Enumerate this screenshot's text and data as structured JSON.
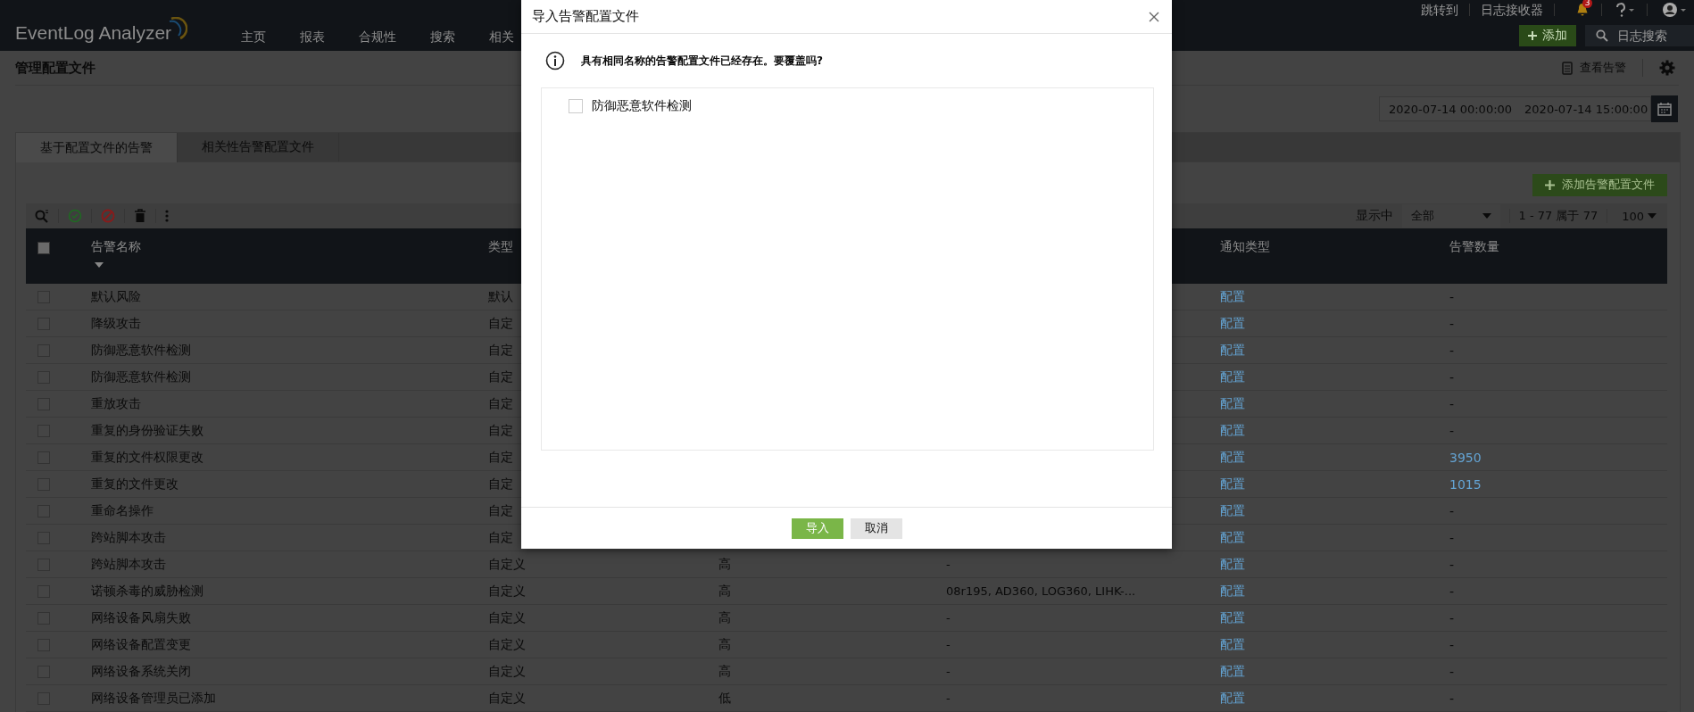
{
  "header": {
    "logo": "EventLog Analyzer",
    "nav": [
      "主页",
      "报表",
      "合规性",
      "搜索",
      "相关"
    ],
    "links": [
      "跳转到",
      "日志接收器"
    ],
    "notification_count": "3",
    "add_button": "添加",
    "search": {
      "placeholder": "日志搜索"
    }
  },
  "page": {
    "title": "管理配置文件",
    "view_alerts": "查看告警",
    "date_range": {
      "from": "2020-07-14 00:00:00",
      "to": "2020-07-14 15:00:00"
    }
  },
  "tabs": [
    {
      "label": "基于配置文件的告警",
      "selected": true
    },
    {
      "label": "相关性告警配置文件",
      "selected": false
    }
  ],
  "add_profile_button": "添加告警配置文件",
  "toolbar": {
    "showing_label": "显示中",
    "filter": "全部",
    "range": "1 - 77 属于 77",
    "page_size": "100"
  },
  "table": {
    "select_all": {
      "checked": false
    },
    "columns": [
      {
        "label": "告警名称",
        "sorted": true
      },
      {
        "label": "类型",
        "sorted": false
      },
      {
        "label": "通知类型",
        "sorted": false
      },
      {
        "label": "告警数量",
        "sorted": false
      }
    ],
    "rows": [
      {
        "name": "默认风险",
        "type": "默认",
        "notify": "配置",
        "count": "-",
        "count_link": false,
        "checked": false
      },
      {
        "name": "降级攻击",
        "type": "自定",
        "notify": "配置",
        "count": "-",
        "count_link": false,
        "checked": false
      },
      {
        "name": "防御恶意软件检测",
        "type": "自定",
        "notify": "配置",
        "count": "-",
        "count_link": false,
        "checked": false
      },
      {
        "name": "防御恶意软件检测",
        "type": "自定",
        "notify": "配置",
        "count": "-",
        "count_link": false,
        "checked": false
      },
      {
        "name": "重放攻击",
        "type": "自定",
        "notify": "配置",
        "count": "-",
        "count_link": false,
        "checked": false
      },
      {
        "name": "重复的身份验证失败",
        "type": "自定",
        "notify": "配置",
        "count": "-",
        "count_link": false,
        "checked": false
      },
      {
        "name": "重复的文件权限更改",
        "type": "自定",
        "notify": "配置",
        "count": "3950",
        "count_link": true,
        "checked": false
      },
      {
        "name": "重复的文件更改",
        "type": "自定",
        "notify": "配置",
        "count": "1015",
        "count_link": true,
        "checked": false
      },
      {
        "name": "重命名操作",
        "type": "自定",
        "notify": "配置",
        "count": "-",
        "count_link": false,
        "checked": false
      },
      {
        "name": "跨站脚本攻击",
        "type": "自定",
        "notify": "配置",
        "count": "-",
        "count_link": false,
        "checked": false
      },
      {
        "name": "跨站脚本攻击",
        "type": "自定义",
        "severity": "高",
        "devices": "-",
        "notify": "配置",
        "count": "-",
        "count_link": false,
        "checked": false
      },
      {
        "name": "诺顿杀毒的威胁检测",
        "type": "自定义",
        "severity": "高",
        "devices": "08r195, AD360, LOG360, LIHK-...",
        "notify": "配置",
        "count": "-",
        "count_link": false,
        "checked": false
      },
      {
        "name": "网络设备风扇失败",
        "type": "自定义",
        "severity": "高",
        "devices": "-",
        "notify": "配置",
        "count": "-",
        "count_link": false,
        "checked": false
      },
      {
        "name": "网络设备配置变更",
        "type": "自定义",
        "severity": "高",
        "devices": "-",
        "notify": "配置",
        "count": "-",
        "count_link": false,
        "checked": false
      },
      {
        "name": "网络设备系统关闭",
        "type": "自定义",
        "severity": "高",
        "devices": "-",
        "notify": "配置",
        "count": "-",
        "count_link": false,
        "checked": false
      },
      {
        "name": "网络设备管理员已添加",
        "type": "自定义",
        "severity": "低",
        "devices": "-",
        "notify": "配置",
        "count": "-",
        "count_link": false,
        "checked": false
      }
    ]
  },
  "dialog": {
    "title": "导入告警配置文件",
    "message": "具有相同名称的告警配置文件已经存在。要覆盖吗?",
    "items": [
      {
        "label": "防御恶意软件检测",
        "checked": false
      }
    ],
    "buttons": [
      {
        "label": "导入",
        "kind": "primary"
      },
      {
        "label": "取消",
        "kind": "secondary"
      }
    ]
  }
}
